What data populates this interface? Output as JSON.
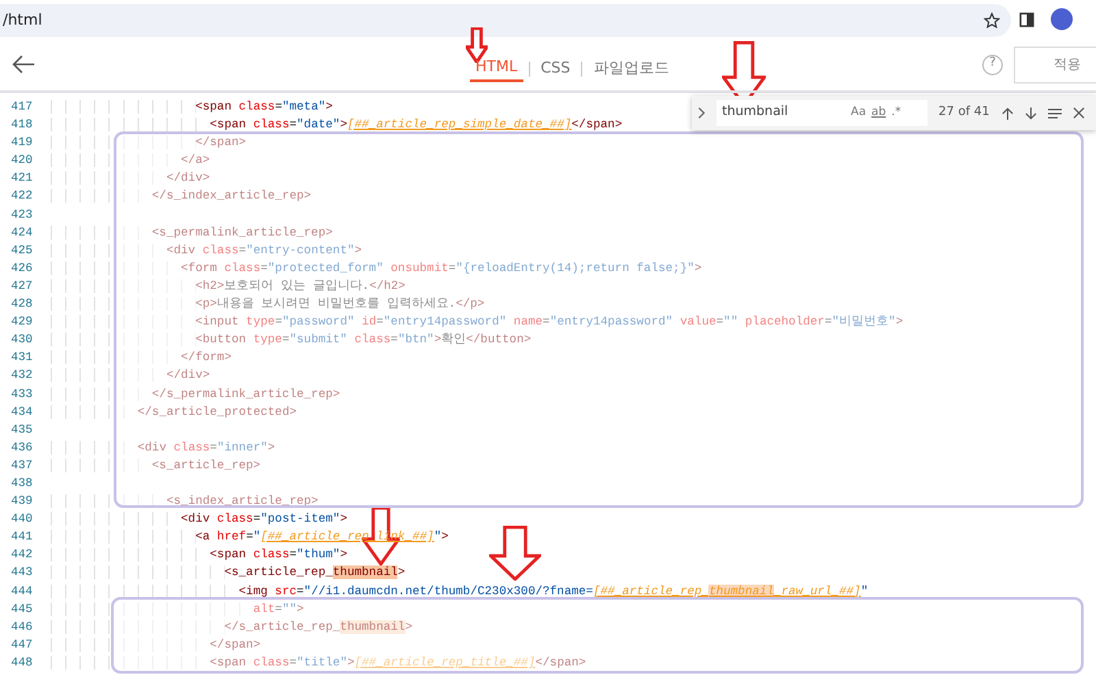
{
  "browser": {
    "address": "/html"
  },
  "editor": {
    "tabs": [
      {
        "label": "HTML",
        "selected": true
      },
      {
        "label": "CSS",
        "selected": false
      },
      {
        "label": "파일업로드",
        "selected": false
      }
    ],
    "help": "?",
    "apply_button": "적용"
  },
  "find": {
    "query": "thumbnail",
    "options": [
      "Aa",
      "ab",
      ".*"
    ],
    "count": "27 of 41"
  },
  "code": [
    {
      "no": "417",
      "segs": [
        {
          "t": "                    <span",
          "kind": "tag"
        },
        {
          "t": " class",
          "kind": "attr"
        },
        {
          "t": "=",
          "kind": "txt"
        },
        {
          "t": "\"meta\"",
          "kind": "str"
        },
        {
          "t": ">",
          "kind": "tag"
        }
      ]
    },
    {
      "no": "418",
      "segs": [
        {
          "t": "                      <span",
          "kind": "tag"
        },
        {
          "t": " class",
          "kind": "attr"
        },
        {
          "t": "=",
          "kind": "txt"
        },
        {
          "t": "\"date\"",
          "kind": "str"
        },
        {
          "t": ">",
          "kind": "tag"
        },
        {
          "t": "[##_article_rep_simple_date_##]",
          "kind": "tpl"
        },
        {
          "t": "</span>",
          "kind": "tag"
        }
      ]
    },
    {
      "no": "419",
      "segs": [
        {
          "t": "                    </span>",
          "kind": "tag"
        }
      ]
    },
    {
      "no": "420",
      "segs": [
        {
          "t": "                  </a>",
          "kind": "tag"
        }
      ]
    },
    {
      "no": "421",
      "segs": [
        {
          "t": "                </div>",
          "kind": "tag"
        }
      ]
    },
    {
      "no": "422",
      "segs": [
        {
          "t": "              </s_index_article_rep>",
          "kind": "tag"
        }
      ]
    },
    {
      "no": "423"
    },
    {
      "no": "424",
      "segs": [
        {
          "t": "              <s_permalink_article_rep>",
          "kind": "tag"
        }
      ]
    },
    {
      "no": "425",
      "segs": [
        {
          "t": "                <div",
          "kind": "tag"
        },
        {
          "t": " class",
          "kind": "attr"
        },
        {
          "t": "=",
          "kind": "txt"
        },
        {
          "t": "\"entry-content\"",
          "kind": "str"
        },
        {
          "t": ">",
          "kind": "tag"
        }
      ]
    },
    {
      "no": "426",
      "segs": [
        {
          "t": "                  <form",
          "kind": "tag"
        },
        {
          "t": " class",
          "kind": "attr"
        },
        {
          "t": "=",
          "kind": "txt"
        },
        {
          "t": "\"protected_form\"",
          "kind": "str"
        },
        {
          "t": " onsubmit",
          "kind": "attr"
        },
        {
          "t": "=",
          "kind": "txt"
        },
        {
          "t": "\"{reloadEntry(14);return false;}\"",
          "kind": "str"
        },
        {
          "t": ">",
          "kind": "tag"
        }
      ]
    },
    {
      "no": "427",
      "segs": [
        {
          "t": "                    <h2>",
          "kind": "tag"
        },
        {
          "t": "보호되어 있는 글입니다.",
          "kind": "txt"
        },
        {
          "t": "</h2>",
          "kind": "tag"
        }
      ]
    },
    {
      "no": "428",
      "segs": [
        {
          "t": "                    <p>",
          "kind": "tag"
        },
        {
          "t": "내용을 보시려면 비밀번호를 입력하세요.",
          "kind": "txt"
        },
        {
          "t": "</p>",
          "kind": "tag"
        }
      ]
    },
    {
      "no": "429",
      "segs": [
        {
          "t": "                    <input",
          "kind": "tag"
        },
        {
          "t": " type",
          "kind": "attr"
        },
        {
          "t": "=",
          "kind": "txt"
        },
        {
          "t": "\"password\"",
          "kind": "str"
        },
        {
          "t": " id",
          "kind": "attr"
        },
        {
          "t": "=",
          "kind": "txt"
        },
        {
          "t": "\"entry14password\"",
          "kind": "str"
        },
        {
          "t": " name",
          "kind": "attr"
        },
        {
          "t": "=",
          "kind": "txt"
        },
        {
          "t": "\"entry14password\"",
          "kind": "str"
        },
        {
          "t": " value",
          "kind": "attr"
        },
        {
          "t": "=",
          "kind": "txt"
        },
        {
          "t": "\"\"",
          "kind": "str"
        },
        {
          "t": " placeholder",
          "kind": "attr"
        },
        {
          "t": "=",
          "kind": "txt"
        },
        {
          "t": "\"비밀번호\"",
          "kind": "str"
        },
        {
          "t": ">",
          "kind": "tag"
        }
      ]
    },
    {
      "no": "430",
      "segs": [
        {
          "t": "                    <button",
          "kind": "tag"
        },
        {
          "t": " type",
          "kind": "attr"
        },
        {
          "t": "=",
          "kind": "txt"
        },
        {
          "t": "\"submit\"",
          "kind": "str"
        },
        {
          "t": " class",
          "kind": "attr"
        },
        {
          "t": "=",
          "kind": "txt"
        },
        {
          "t": "\"btn\"",
          "kind": "str"
        },
        {
          "t": ">",
          "kind": "tag"
        },
        {
          "t": "확인",
          "kind": "txt"
        },
        {
          "t": "</button>",
          "kind": "tag"
        }
      ]
    },
    {
      "no": "431",
      "segs": [
        {
          "t": "                  </form>",
          "kind": "tag"
        }
      ]
    },
    {
      "no": "432",
      "segs": [
        {
          "t": "                </div>",
          "kind": "tag"
        }
      ]
    },
    {
      "no": "433",
      "segs": [
        {
          "t": "              </s_permalink_article_rep>",
          "kind": "tag"
        }
      ]
    },
    {
      "no": "434",
      "segs": [
        {
          "t": "            </s_article_protected>",
          "kind": "tag"
        }
      ]
    },
    {
      "no": "435"
    },
    {
      "no": "436",
      "segs": [
        {
          "t": "            <div",
          "kind": "tag"
        },
        {
          "t": " class",
          "kind": "attr"
        },
        {
          "t": "=",
          "kind": "txt"
        },
        {
          "t": "\"inner\"",
          "kind": "str"
        },
        {
          "t": ">",
          "kind": "tag"
        }
      ]
    },
    {
      "no": "437",
      "segs": [
        {
          "t": "              <s_article_rep>",
          "kind": "tag"
        }
      ]
    },
    {
      "no": "438"
    },
    {
      "no": "439",
      "segs": [
        {
          "t": "                <s_index_article_rep>",
          "kind": "tag"
        }
      ]
    },
    {
      "no": "440",
      "segs": [
        {
          "t": "                  <div",
          "kind": "tag"
        },
        {
          "t": " class",
          "kind": "attr"
        },
        {
          "t": "=",
          "kind": "txt"
        },
        {
          "t": "\"post-item\"",
          "kind": "str"
        },
        {
          "t": ">",
          "kind": "tag"
        }
      ]
    },
    {
      "no": "441",
      "segs": [
        {
          "t": "                    <a",
          "kind": "tag"
        },
        {
          "t": " href",
          "kind": "attr"
        },
        {
          "t": "=",
          "kind": "txt"
        },
        {
          "t": "\"",
          "kind": "str"
        },
        {
          "t": "[##_article_rep_link_##]",
          "kind": "tpl"
        },
        {
          "t": "\"",
          "kind": "str"
        },
        {
          "t": ">",
          "kind": "tag"
        }
      ]
    },
    {
      "no": "442",
      "segs": [
        {
          "t": "                      <span",
          "kind": "tag"
        },
        {
          "t": " class",
          "kind": "attr"
        },
        {
          "t": "=",
          "kind": "txt"
        },
        {
          "t": "\"thum\"",
          "kind": "str"
        },
        {
          "t": ">",
          "kind": "tag"
        }
      ]
    },
    {
      "no": "443",
      "segs": [
        {
          "t": "                        <s_article_rep_",
          "kind": "tag"
        },
        {
          "t": "thumbnail",
          "kind": "tag",
          "match": true,
          "current": true
        },
        {
          "t": ">",
          "kind": "tag"
        }
      ]
    },
    {
      "no": "444",
      "segs": [
        {
          "t": "                          <img",
          "kind": "tag"
        },
        {
          "t": " src",
          "kind": "attr"
        },
        {
          "t": "=",
          "kind": "txt"
        },
        {
          "t": "\"//i1.daumcdn.net/thumb/C230x300/?fname=",
          "kind": "str"
        },
        {
          "t": "[##_article_rep_",
          "kind": "tpl"
        },
        {
          "t": "thumbnail",
          "kind": "tpl",
          "match": true,
          "current": false
        },
        {
          "t": "_raw_url_##]",
          "kind": "tpl"
        },
        {
          "t": "\"",
          "kind": "str"
        }
      ]
    },
    {
      "no": "445",
      "segs": [
        {
          "t": "                            alt",
          "kind": "attr"
        },
        {
          "t": "=",
          "kind": "txt"
        },
        {
          "t": "\"\"",
          "kind": "str"
        },
        {
          "t": ">",
          "kind": "tag"
        }
      ]
    },
    {
      "no": "446",
      "segs": [
        {
          "t": "                        </s_article_rep_",
          "kind": "tag"
        },
        {
          "t": "thumbnail",
          "kind": "tag",
          "match": true,
          "current": false
        },
        {
          "t": ">",
          "kind": "tag"
        }
      ]
    },
    {
      "no": "447",
      "segs": [
        {
          "t": "                      </span>",
          "kind": "tag"
        }
      ]
    },
    {
      "no": "448",
      "segs": [
        {
          "t": "                      <span",
          "kind": "tag"
        },
        {
          "t": " class",
          "kind": "attr"
        },
        {
          "t": "=",
          "kind": "txt"
        },
        {
          "t": "\"title\"",
          "kind": "str"
        },
        {
          "t": ">",
          "kind": "tag"
        },
        {
          "t": "[##_article_rep_title_##]",
          "kind": "tpl"
        },
        {
          "t": "</span>",
          "kind": "tag"
        }
      ]
    }
  ],
  "annotations": [
    {
      "kind": "arrow"
    },
    {
      "kind": "arrow"
    },
    {
      "kind": "arrow"
    },
    {
      "kind": "arrow"
    },
    {
      "kind": "frame"
    },
    {
      "kind": "frame"
    }
  ]
}
